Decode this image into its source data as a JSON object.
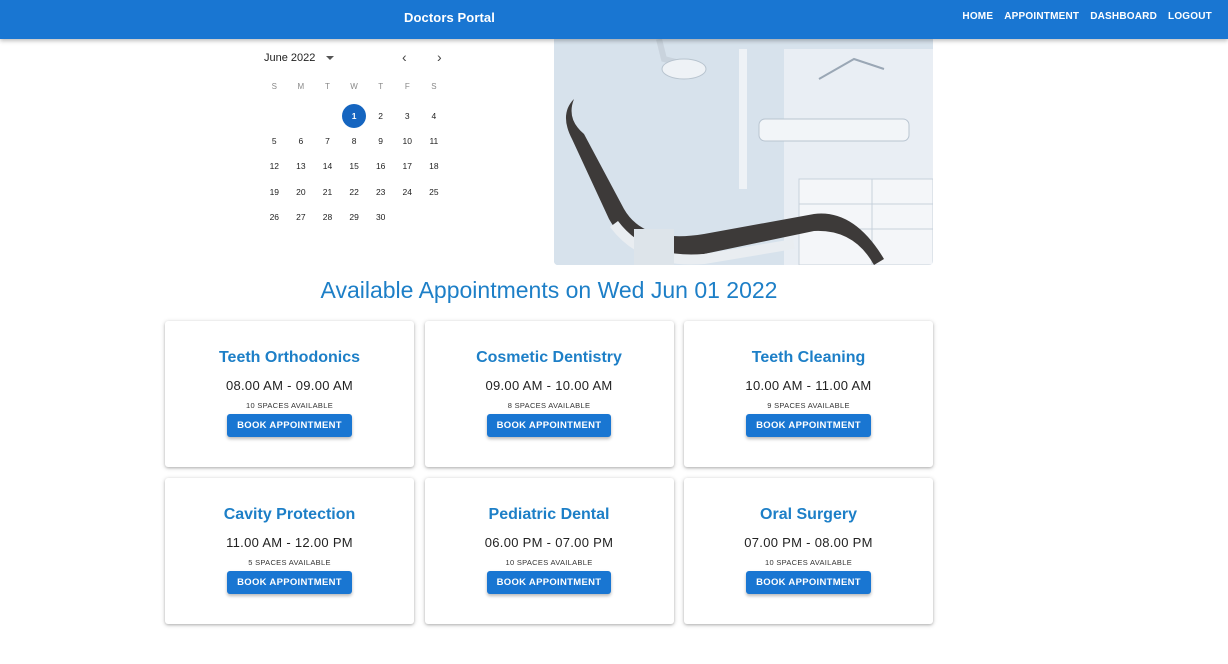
{
  "header": {
    "brand": "Doctors Portal",
    "nav": [
      "Home",
      "Appointment",
      "Dashboard",
      "Logout"
    ]
  },
  "calendar": {
    "month_label": "June 2022",
    "weekdays": [
      "S",
      "M",
      "T",
      "W",
      "T",
      "F",
      "S"
    ],
    "first_weekday_index": 3,
    "days": [
      "1",
      "2",
      "3",
      "4",
      "5",
      "6",
      "7",
      "8",
      "9",
      "10",
      "11",
      "12",
      "13",
      "14",
      "15",
      "16",
      "17",
      "18",
      "19",
      "20",
      "21",
      "22",
      "23",
      "24",
      "25",
      "26",
      "27",
      "28",
      "29",
      "30"
    ],
    "selected_day": "1"
  },
  "hero": {
    "icon": "dental-chair-photo"
  },
  "appointments": {
    "title": "Available Appointments on Wed Jun 01 2022",
    "cards": [
      {
        "name": "Teeth Orthodonics",
        "time": "08.00 AM - 09.00 AM",
        "spaces": "10 spaces available",
        "button": "Book Appointment"
      },
      {
        "name": "Cosmetic Dentistry",
        "time": "09.00 AM - 10.00 AM",
        "spaces": "8 spaces available",
        "button": "Book Appointment"
      },
      {
        "name": "Teeth Cleaning",
        "time": "10.00 AM - 11.00 AM",
        "spaces": "9 spaces available",
        "button": "Book Appointment"
      },
      {
        "name": "Cavity Protection",
        "time": "11.00 AM - 12.00 PM",
        "spaces": "5 spaces available",
        "button": "Book Appointment"
      },
      {
        "name": "Pediatric Dental",
        "time": "06.00 PM - 07.00 PM",
        "spaces": "10 spaces available",
        "button": "Book Appointment"
      },
      {
        "name": "Oral Surgery",
        "time": "07.00 PM - 08.00 PM",
        "spaces": "10 spaces available",
        "button": "Book Appointment"
      }
    ]
  },
  "colors": {
    "primary": "#1976d2",
    "heading": "#1d7fc7"
  }
}
